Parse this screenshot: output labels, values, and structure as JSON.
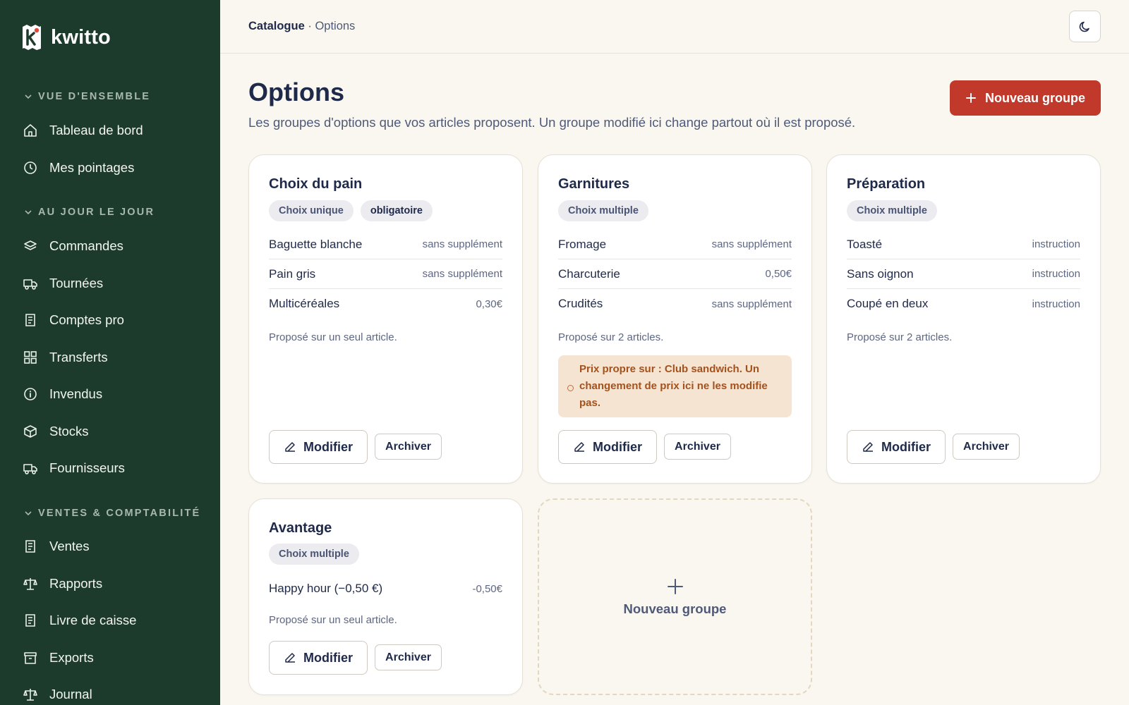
{
  "brand": {
    "name": "kwitto",
    "logo_letter": "k"
  },
  "sidebar": {
    "sections": [
      {
        "label": "VUE D'ENSEMBLE"
      },
      {
        "label": "AU JOUR LE JOUR"
      },
      {
        "label": "VENTES & COMPTABILITÉ"
      }
    ],
    "items": [
      {
        "label": "Tableau de bord",
        "icon": "home-icon"
      },
      {
        "label": "Mes pointages",
        "icon": "clock-icon"
      },
      {
        "label": "Commandes",
        "icon": "layers-icon"
      },
      {
        "label": "Tournées",
        "icon": "truck-icon"
      },
      {
        "label": "Comptes pro",
        "icon": "receipt-icon"
      },
      {
        "label": "Transferts",
        "icon": "grid-icon"
      },
      {
        "label": "Invendus",
        "icon": "info-icon"
      },
      {
        "label": "Stocks",
        "icon": "box-icon"
      },
      {
        "label": "Fournisseurs",
        "icon": "truck-icon"
      },
      {
        "label": "Ventes",
        "icon": "receipt-icon"
      },
      {
        "label": "Rapports",
        "icon": "scale-icon"
      },
      {
        "label": "Livre de caisse",
        "icon": "receipt-icon"
      },
      {
        "label": "Exports",
        "icon": "archive-icon"
      },
      {
        "label": "Journal",
        "icon": "scale-icon"
      }
    ]
  },
  "header": {
    "breadcrumb_parent": "Catalogue",
    "breadcrumb_sep": " · ",
    "breadcrumb_current": "Options",
    "theme_icon": "moon-icon"
  },
  "page": {
    "title": "Options",
    "subtitle": "Les groupes d'options que vos articles proposent. Un groupe modifié ici change partout où il est proposé.",
    "new_group_label": "Nouveau groupe"
  },
  "groups": [
    {
      "title": "Choix du pain",
      "tags": [
        "Choix unique",
        "obligatoire"
      ],
      "options": [
        {
          "name": "Baguette blanche",
          "price": "sans supplément"
        },
        {
          "name": "Pain gris",
          "price": "sans supplément"
        },
        {
          "name": "Multicéréales",
          "price": "0,30€"
        }
      ],
      "note": "Proposé sur un seul article.",
      "edit_label": "Modifier",
      "archive_label": "Archiver"
    },
    {
      "title": "Garnitures",
      "tags": [
        "Choix multiple"
      ],
      "options": [
        {
          "name": "Fromage",
          "price": "sans supplément"
        },
        {
          "name": "Charcuterie",
          "price": "0,50€"
        },
        {
          "name": "Crudités",
          "price": "sans supplément"
        }
      ],
      "note": "Proposé sur 2 articles.",
      "warning": "Prix propre sur : Club sandwich. Un changement de prix ici ne les modifie pas.",
      "edit_label": "Modifier",
      "archive_label": "Archiver"
    },
    {
      "title": "Préparation",
      "tags": [
        "Choix multiple"
      ],
      "options": [
        {
          "name": "Toasté",
          "price": "instruction"
        },
        {
          "name": "Sans oignon",
          "price": "instruction"
        },
        {
          "name": "Coupé en deux",
          "price": "instruction"
        }
      ],
      "note": "Proposé sur 2 articles.",
      "edit_label": "Modifier",
      "archive_label": "Archiver"
    },
    {
      "title": "Avantage",
      "tags": [
        "Choix multiple"
      ],
      "options": [
        {
          "name": "Happy hour (−0,50 €)",
          "price": "-0,50€"
        }
      ],
      "note": "Proposé sur un seul article.",
      "edit_label": "Modifier",
      "archive_label": "Archiver"
    }
  ],
  "new_card": {
    "label": "Nouveau groupe"
  },
  "colors": {
    "sidebar": "#1c3b2c",
    "accent": "#c0392b",
    "background": "#faf7f0",
    "warning_bg": "#f6e4d3"
  }
}
